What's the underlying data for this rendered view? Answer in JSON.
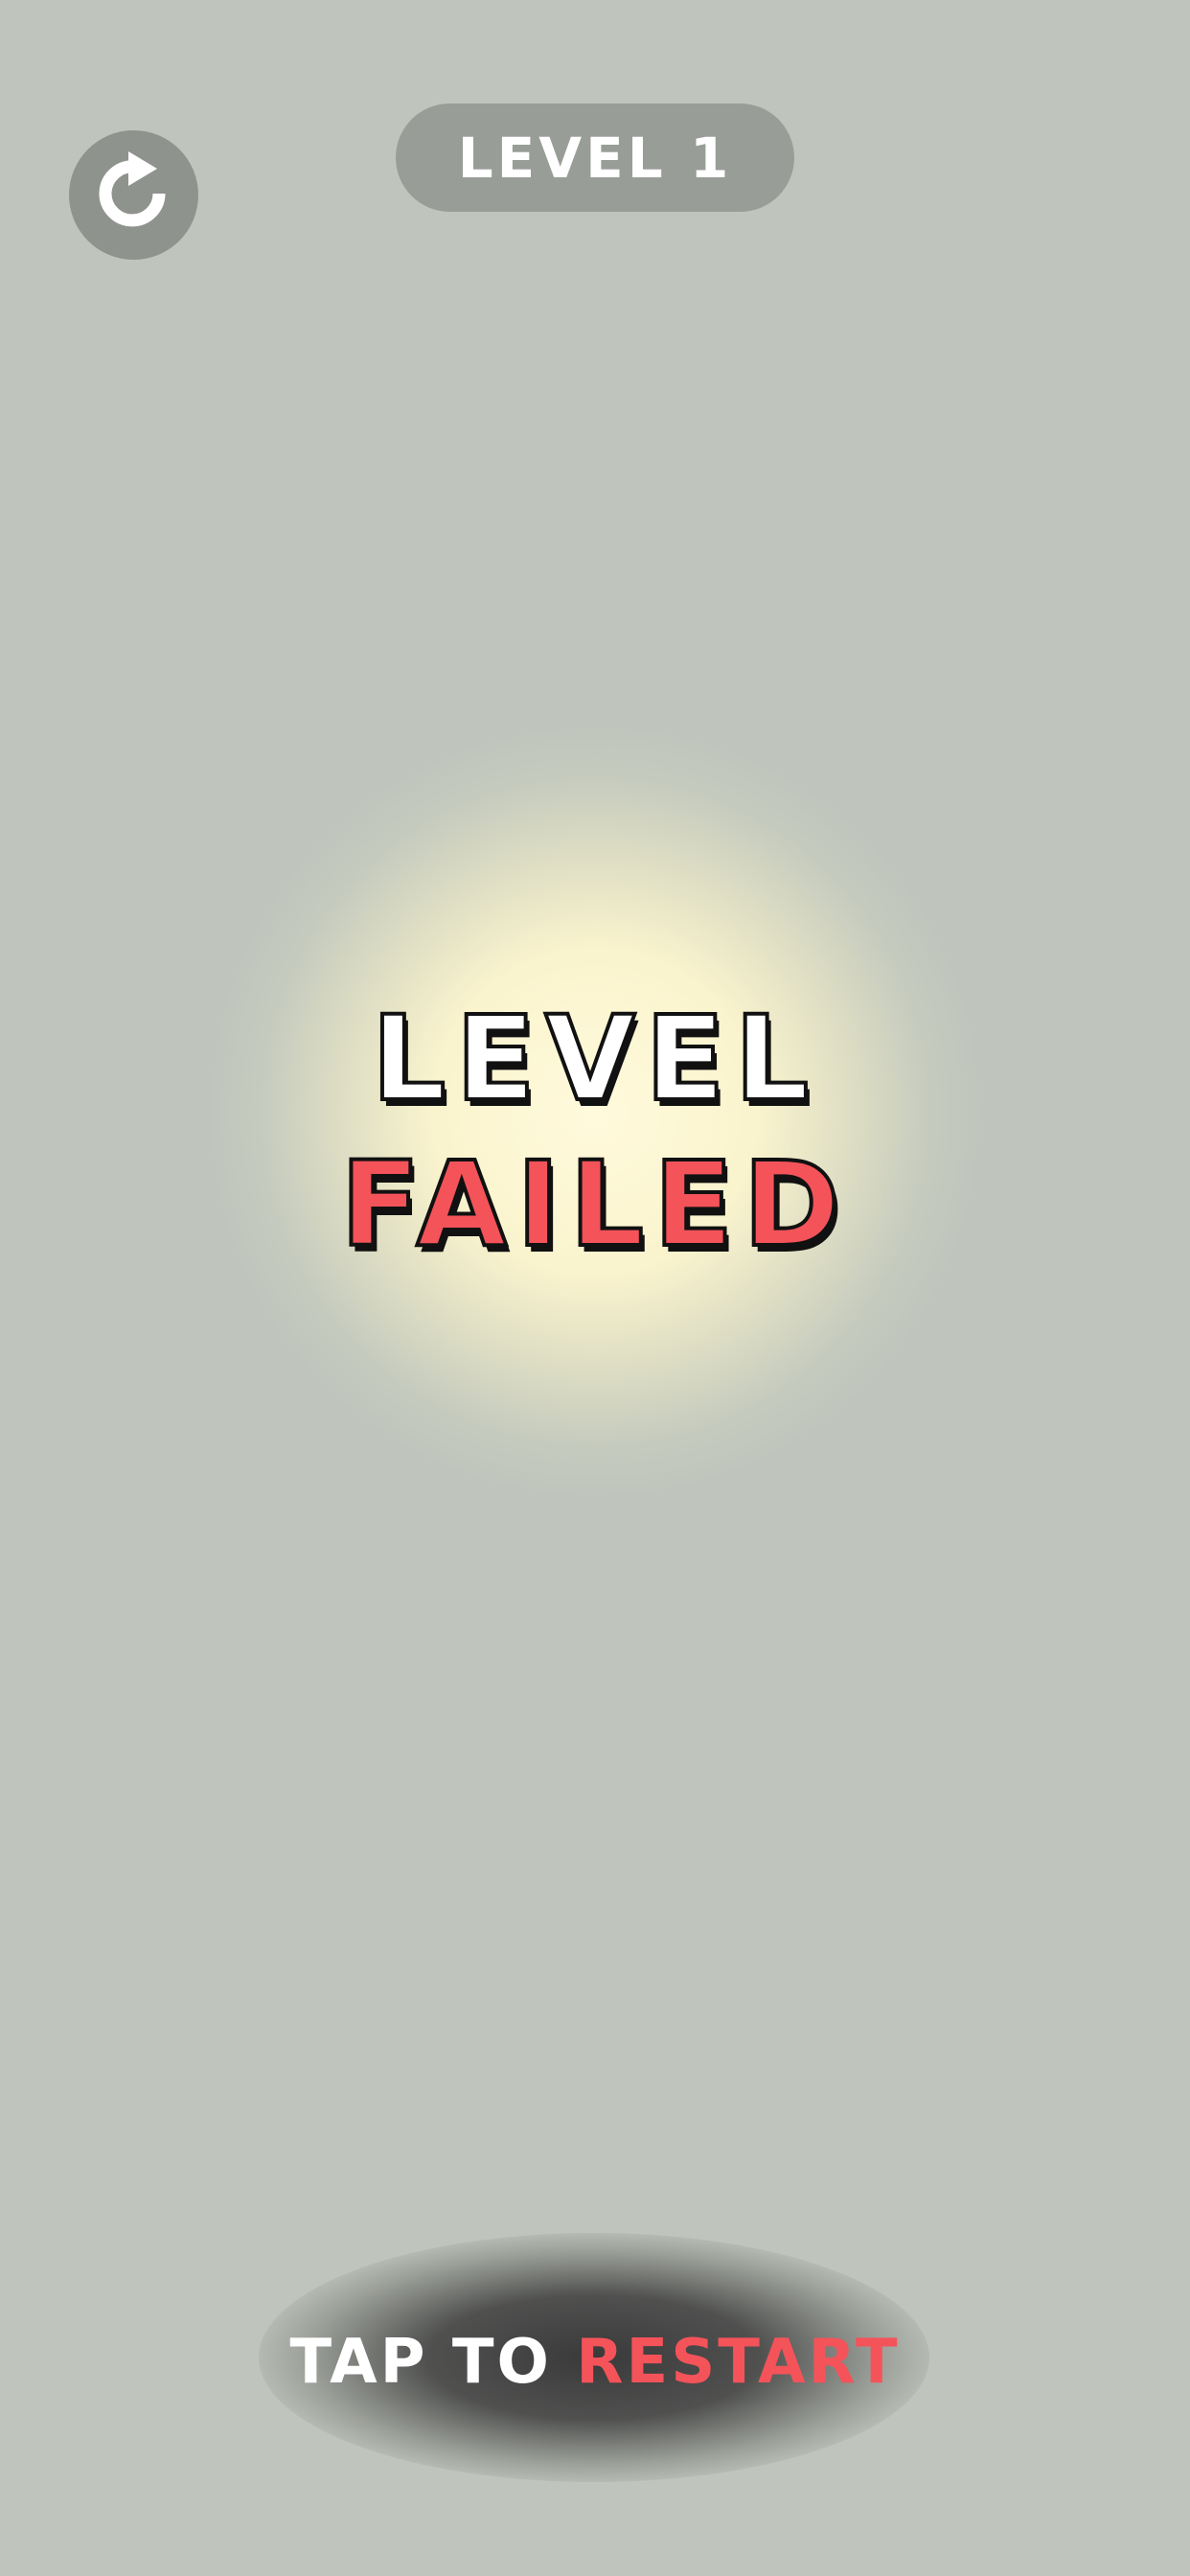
{
  "header": {
    "level_label": "LEVEL 1"
  },
  "icons": {
    "restart": "restart-icon"
  },
  "result": {
    "line1": "LEVEL",
    "line2": "FAILED"
  },
  "footer": {
    "tap_prefix": "TAP TO ",
    "tap_action": "RESTART"
  },
  "colors": {
    "background": "#bfc5bc",
    "accent_red": "#f4535a",
    "pill": "#999d97",
    "icon_button": "#8f938d"
  }
}
